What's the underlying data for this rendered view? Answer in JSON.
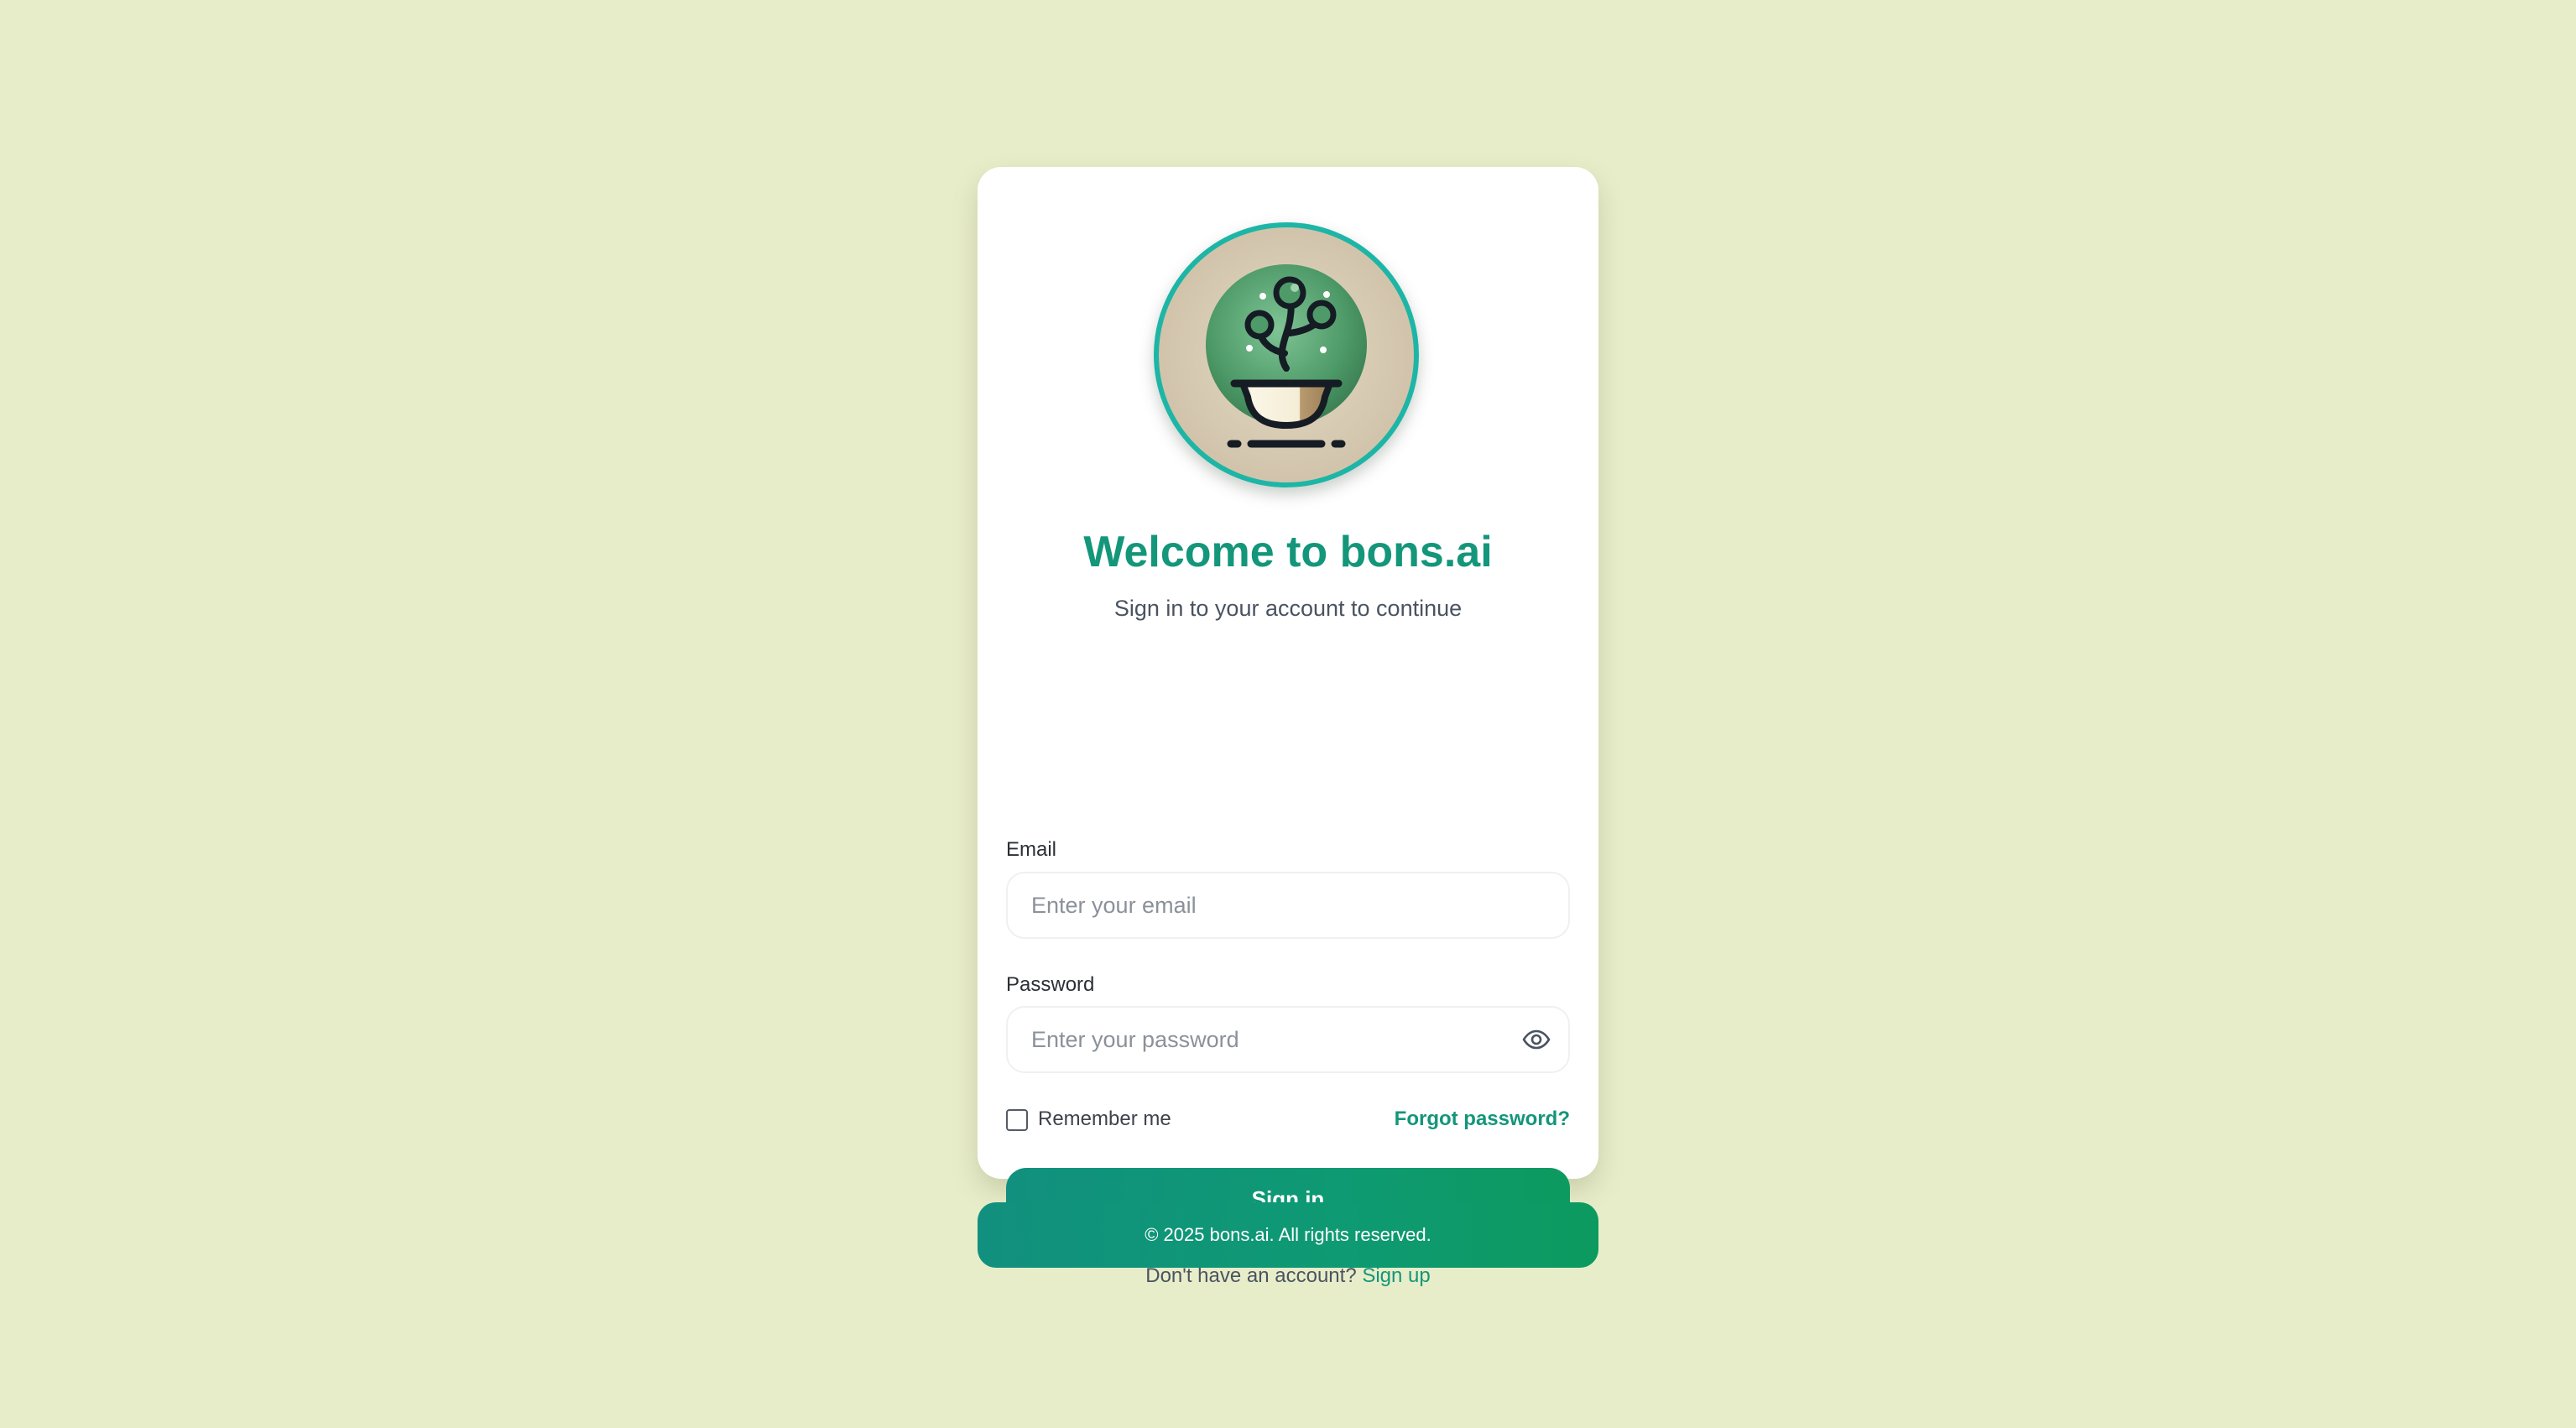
{
  "header": {
    "logo_icon": "bonsai-logo-icon",
    "title": "Welcome to bons.ai",
    "subtitle": "Sign in to your account to continue"
  },
  "form": {
    "email": {
      "label": "Email",
      "placeholder": "Enter your email",
      "value": ""
    },
    "password": {
      "label": "Password",
      "placeholder": "Enter your password",
      "value": "",
      "toggle_icon": "eye-icon"
    },
    "remember_label": "Remember me",
    "remember_checked": false,
    "forgot_label": "Forgot password?",
    "submit_label": "Sign in"
  },
  "signup": {
    "prompt": "Don't have an account?",
    "link_label": "Sign up"
  },
  "footer": {
    "text": "© 2025 bons.ai. All rights reserved."
  },
  "colors": {
    "background": "#e8edc9",
    "accent": "#13967a",
    "accent_gradient_end": "#0d9a5f",
    "logo_ring": "#1db5a6"
  }
}
